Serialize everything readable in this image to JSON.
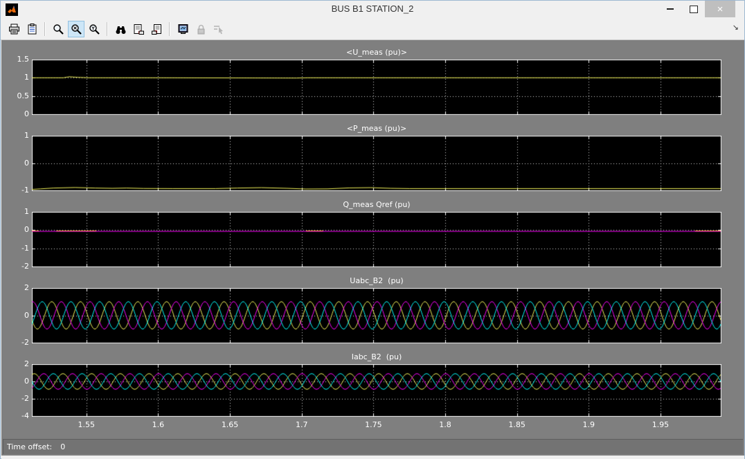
{
  "window": {
    "title": "BUS B1 STATION_2",
    "close_glyph": "×"
  },
  "toolbar": {
    "buttons": [
      {
        "name": "print",
        "icon": "printer-icon"
      },
      {
        "name": "parameters",
        "icon": "parameters-icon"
      },
      {
        "name": "zoom",
        "icon": "zoom-icon"
      },
      {
        "name": "zoom-x",
        "icon": "zoom-x-icon",
        "selected": true
      },
      {
        "name": "zoom-y",
        "icon": "zoom-y-icon"
      },
      {
        "name": "autoscale",
        "icon": "binoculars-icon"
      },
      {
        "name": "save-axes",
        "icon": "save-axes-icon"
      },
      {
        "name": "restore-axes",
        "icon": "restore-axes-icon"
      },
      {
        "name": "floating-scope",
        "icon": "floating-scope-icon"
      },
      {
        "name": "lock-axes",
        "icon": "lock-icon",
        "disabled": true
      },
      {
        "name": "signal-selection",
        "icon": "signal-selection-icon",
        "disabled": true
      }
    ],
    "overflow_glyph": "↘"
  },
  "status_bar": {
    "label": "Time offset:",
    "value": "0"
  },
  "chart_data": [
    {
      "type": "line",
      "title": "<U_meas (pu)>",
      "x_range": [
        1.512,
        1.992
      ],
      "x_ticks": [
        1.55,
        1.6,
        1.65,
        1.7,
        1.75,
        1.8,
        1.85,
        1.9,
        1.95
      ],
      "x_tick_labels": [
        "1.55",
        "1.6",
        "1.65",
        "1.7",
        "1.75",
        "1.8",
        "1.85",
        "1.9",
        "1.95"
      ],
      "show_x_labels": false,
      "y_range": [
        0,
        1.5
      ],
      "y_tick_values": [
        0,
        0.5,
        1,
        1.5
      ],
      "y_tick_labels": [
        "0",
        "0.5",
        "1",
        "1.5"
      ],
      "grid_y": [
        0.5,
        1
      ],
      "bg": "#000000",
      "series": [
        {
          "name": "U_meas",
          "color": "#f2f25a",
          "kind": "points",
          "points": [
            [
              1.512,
              1.0
            ],
            [
              1.534,
              1.0
            ],
            [
              1.538,
              1.028
            ],
            [
              1.544,
              1.012
            ],
            [
              1.552,
              1.0
            ],
            [
              1.6,
              1.0
            ],
            [
              1.696,
              0.992
            ],
            [
              1.704,
              1.0
            ],
            [
              1.8,
              1.0
            ],
            [
              1.9,
              1.0
            ],
            [
              1.992,
              1.0
            ]
          ]
        }
      ]
    },
    {
      "type": "line",
      "title": "<P_meas (pu)>",
      "x_range": [
        1.512,
        1.992
      ],
      "x_ticks": [
        1.55,
        1.6,
        1.65,
        1.7,
        1.75,
        1.8,
        1.85,
        1.9,
        1.95
      ],
      "x_tick_labels": [
        "1.55",
        "1.6",
        "1.65",
        "1.7",
        "1.75",
        "1.8",
        "1.85",
        "1.9",
        "1.95"
      ],
      "show_x_labels": false,
      "y_range": [
        -1,
        1
      ],
      "y_tick_values": [
        -1,
        0,
        1
      ],
      "y_tick_labels": [
        "-1",
        "0",
        "1"
      ],
      "grid_y": [
        0
      ],
      "bg": "#000000",
      "series": [
        {
          "name": "P_meas",
          "color": "#f2f25a",
          "kind": "points",
          "points": [
            [
              1.512,
              -0.965
            ],
            [
              1.518,
              -0.945
            ],
            [
              1.527,
              -0.915
            ],
            [
              1.542,
              -0.895
            ],
            [
              1.556,
              -0.915
            ],
            [
              1.568,
              -0.925
            ],
            [
              1.578,
              -0.915
            ],
            [
              1.59,
              -0.93
            ],
            [
              1.61,
              -0.935
            ],
            [
              1.64,
              -0.935
            ],
            [
              1.655,
              -0.915
            ],
            [
              1.672,
              -0.9
            ],
            [
              1.69,
              -0.925
            ],
            [
              1.703,
              -0.95
            ],
            [
              1.718,
              -0.945
            ],
            [
              1.733,
              -0.91
            ],
            [
              1.748,
              -0.9
            ],
            [
              1.762,
              -0.925
            ],
            [
              1.775,
              -0.935
            ],
            [
              1.85,
              -0.935
            ],
            [
              1.9,
              -0.935
            ],
            [
              1.992,
              -0.935
            ]
          ]
        }
      ]
    },
    {
      "type": "line",
      "title": "Q_meas Qref (pu)",
      "x_range": [
        1.512,
        1.992
      ],
      "x_ticks": [
        1.55,
        1.6,
        1.65,
        1.7,
        1.75,
        1.8,
        1.85,
        1.9,
        1.95
      ],
      "x_tick_labels": [
        "1.55",
        "1.6",
        "1.65",
        "1.7",
        "1.75",
        "1.8",
        "1.85",
        "1.9",
        "1.95"
      ],
      "show_x_labels": false,
      "y_range": [
        -2,
        1
      ],
      "y_tick_values": [
        -2,
        -1,
        0,
        1
      ],
      "y_tick_labels": [
        "-2",
        "-1",
        "0",
        "1"
      ],
      "grid_y": [
        -1,
        0
      ],
      "bg": "#000000",
      "series": [
        {
          "name": "Q_meas",
          "color": "#ff00ff",
          "kind": "points",
          "points": [
            [
              1.512,
              -0.07
            ],
            [
              1.992,
              -0.07
            ]
          ]
        },
        {
          "name": "Qref",
          "color": "#ff8c46",
          "kind": "segments",
          "level": -0.035,
          "ranges": [
            [
              1.512,
              1.517
            ],
            [
              1.529,
              1.557
            ],
            [
              1.703,
              1.715
            ],
            [
              1.974,
              1.992
            ]
          ]
        }
      ]
    },
    {
      "type": "line",
      "title": "Uabc_B2  (pu)",
      "x_range": [
        1.512,
        1.992
      ],
      "x_ticks": [
        1.55,
        1.6,
        1.65,
        1.7,
        1.75,
        1.8,
        1.85,
        1.9,
        1.95
      ],
      "x_tick_labels": [
        "1.55",
        "1.6",
        "1.65",
        "1.7",
        "1.75",
        "1.8",
        "1.85",
        "1.9",
        "1.95"
      ],
      "show_x_labels": false,
      "y_range": [
        -2,
        2
      ],
      "y_tick_values": [
        -2,
        0,
        2
      ],
      "y_tick_labels": [
        "-2",
        "0",
        "2"
      ],
      "grid_y": [
        0
      ],
      "bg": "#000000",
      "series": [
        {
          "name": "Ua",
          "color": "#f2f25a",
          "kind": "sine",
          "freq": 50,
          "amp": 1.0,
          "phase_deg": 200,
          "offset": 0
        },
        {
          "name": "Ub",
          "color": "#ff00ff",
          "kind": "sine",
          "freq": 50,
          "amp": 1.0,
          "phase_deg": 80,
          "offset": 0
        },
        {
          "name": "Uc",
          "color": "#00ffff",
          "kind": "sine",
          "freq": 50,
          "amp": 1.0,
          "phase_deg": 320,
          "offset": 0
        }
      ]
    },
    {
      "type": "line",
      "title": "Iabc_B2  (pu)",
      "x_range": [
        1.512,
        1.992
      ],
      "x_ticks": [
        1.55,
        1.6,
        1.65,
        1.7,
        1.75,
        1.8,
        1.85,
        1.9,
        1.95
      ],
      "x_tick_labels": [
        "1.55",
        "1.6",
        "1.65",
        "1.7",
        "1.75",
        "1.8",
        "1.85",
        "1.9",
        "1.95"
      ],
      "show_x_labels": true,
      "y_range": [
        -4,
        2
      ],
      "y_tick_values": [
        -4,
        -2,
        0,
        2
      ],
      "y_tick_labels": [
        "-4",
        "-2",
        "0",
        "2"
      ],
      "grid_y": [
        -2,
        0
      ],
      "bg": "#000000",
      "series": [
        {
          "name": "Ia",
          "color": "#f2f25a",
          "kind": "sine",
          "freq": 50,
          "amp": 0.9,
          "phase_deg": 60,
          "offset": 0
        },
        {
          "name": "Ib",
          "color": "#ff00ff",
          "kind": "sine",
          "freq": 50,
          "amp": 0.9,
          "phase_deg": 300,
          "offset": 0
        },
        {
          "name": "Ic",
          "color": "#00ffff",
          "kind": "sine",
          "freq": 50,
          "amp": 0.9,
          "phase_deg": 180,
          "offset": 0
        }
      ]
    }
  ],
  "colors": {
    "figure_bg": "#7f7f7f",
    "plot_bg": "#000000",
    "axis": "#ffffff",
    "trace_yellow": "#f2f25a",
    "trace_magenta": "#ff00ff",
    "trace_cyan": "#00ffff",
    "trace_orange": "#ff8c46"
  }
}
